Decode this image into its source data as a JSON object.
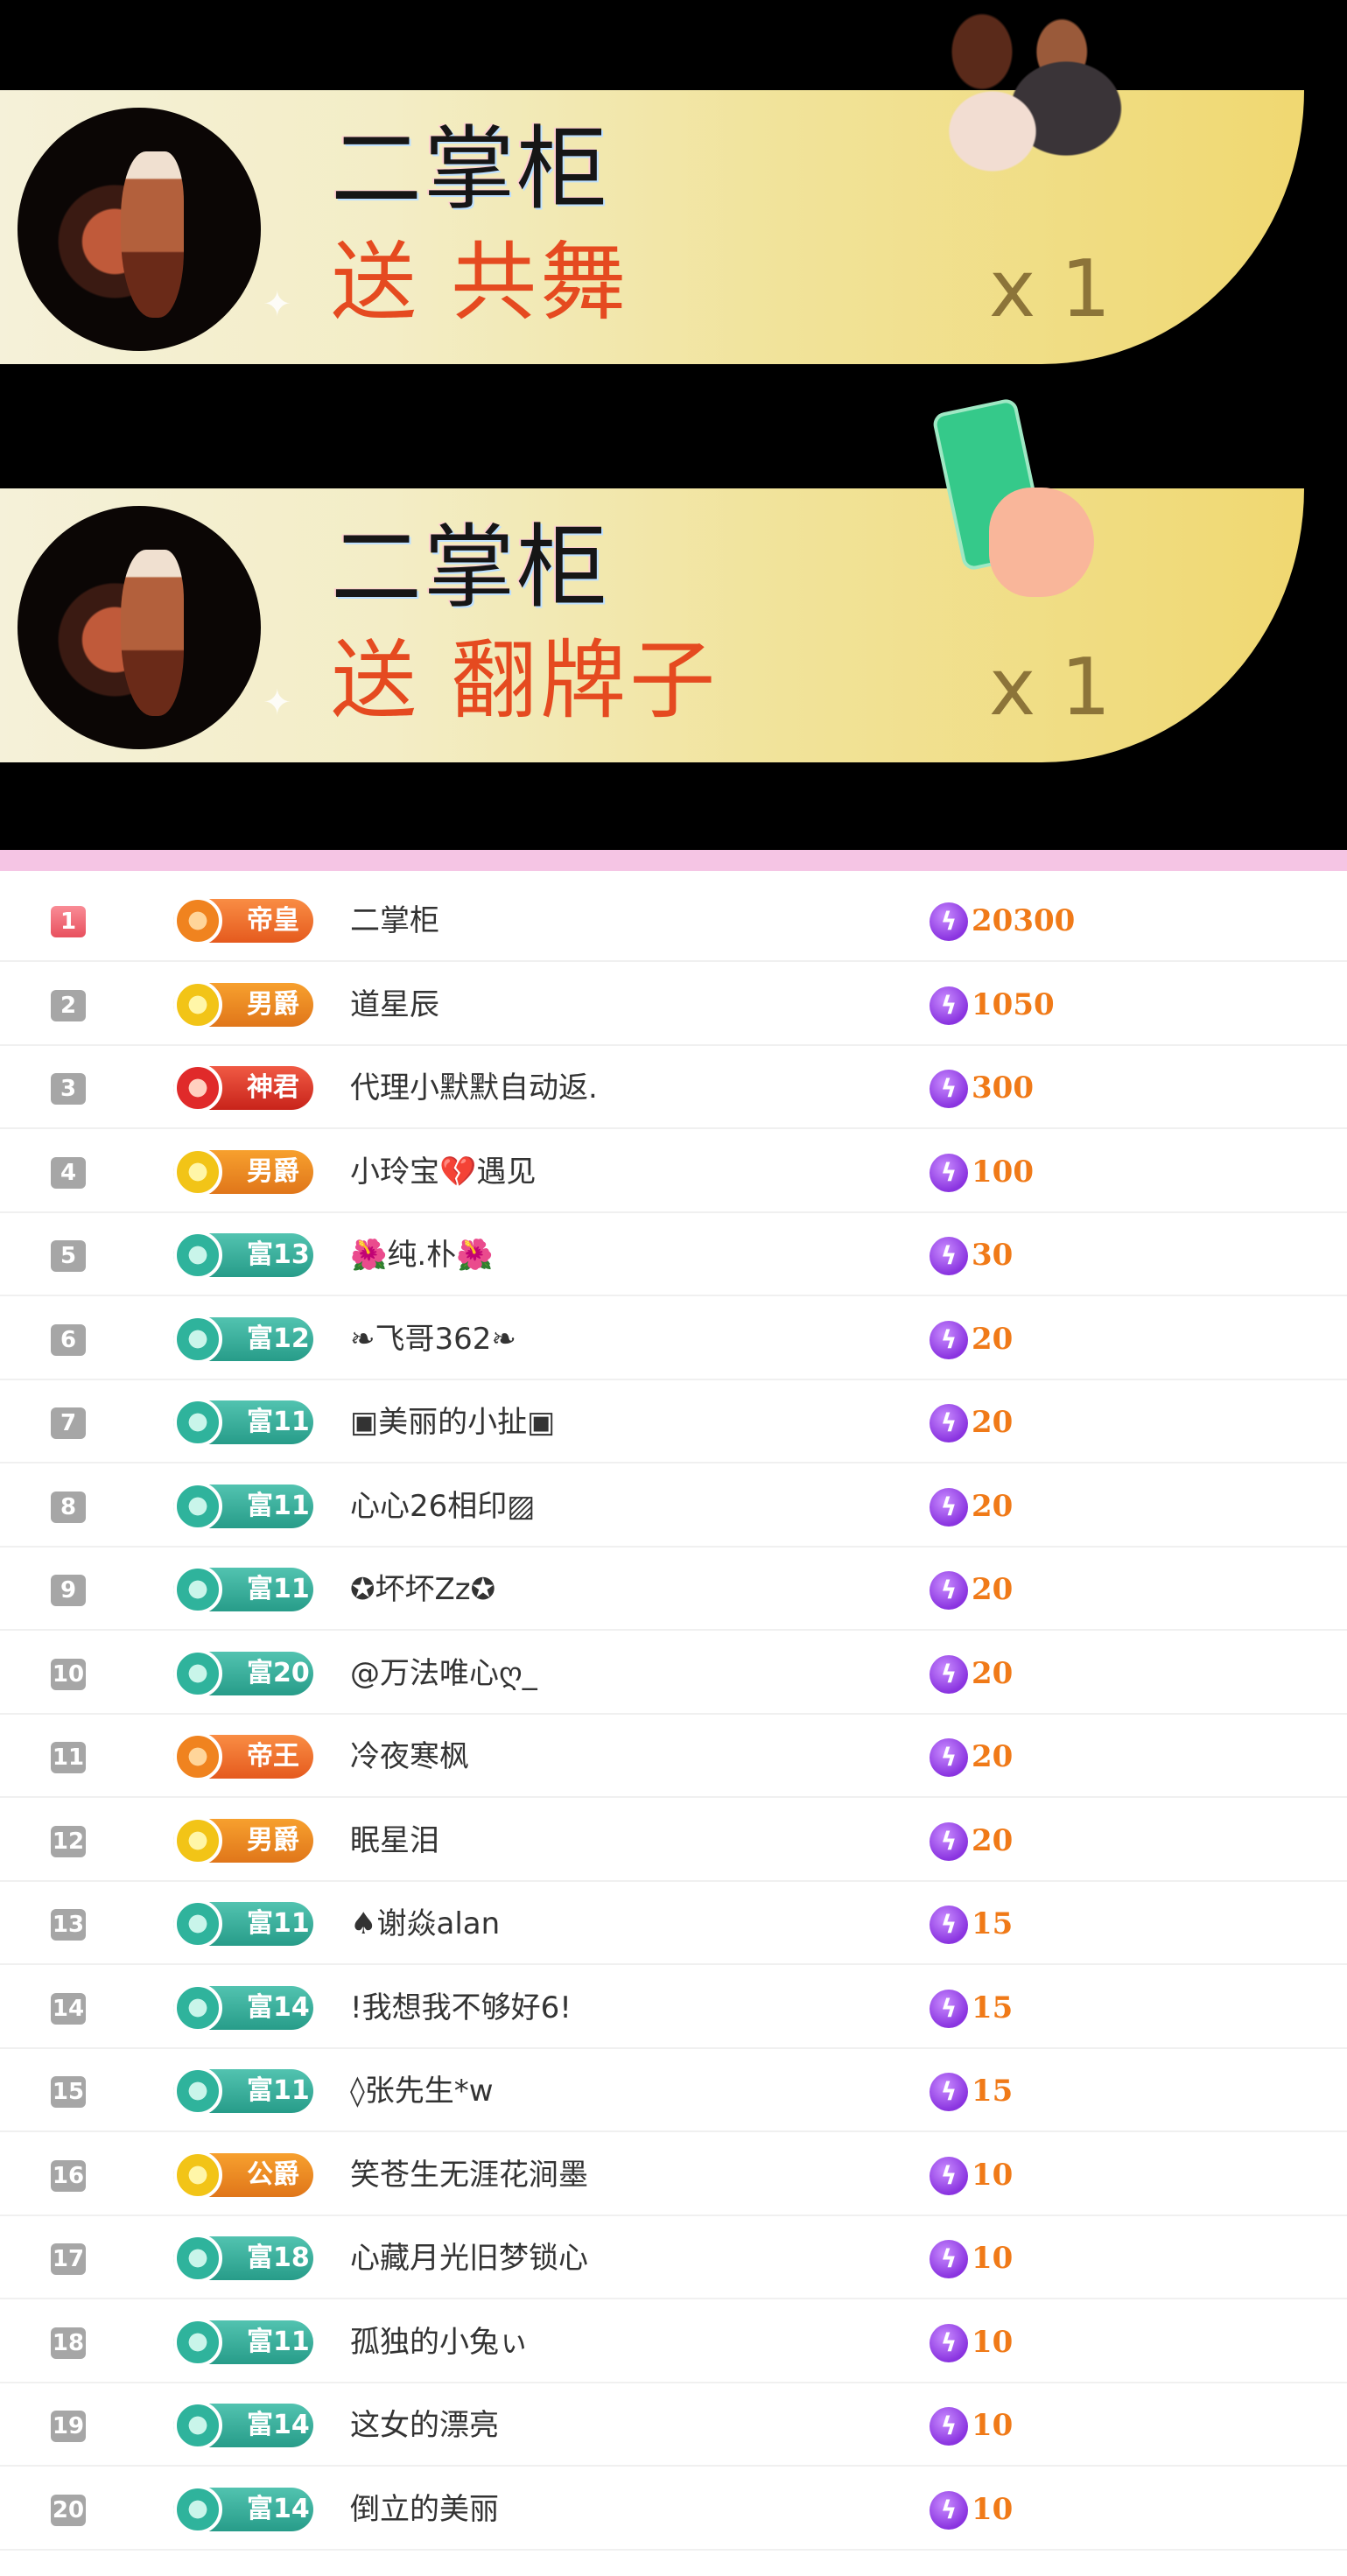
{
  "banners": [
    {
      "sender": "二掌柜",
      "action": "送 共舞",
      "count": "x 1",
      "gift_icon": "couple-dance-gift-icon"
    },
    {
      "sender": "二掌柜",
      "action": "送 翻牌子",
      "count": "x 1",
      "gift_icon": "flip-card-gift-icon"
    }
  ],
  "colors": {
    "accent_pink": "#f5c5e4",
    "amount_orange": "#f07a18",
    "coin_purple": "#8a34e0"
  },
  "ranking": [
    {
      "rank": "1",
      "badge": "帝皇",
      "badge_style": "orange",
      "name": "二掌柜",
      "amount": "20300"
    },
    {
      "rank": "2",
      "badge": "男爵",
      "badge_style": "gold",
      "name": "道星辰",
      "amount": "1050"
    },
    {
      "rank": "3",
      "badge": "神君",
      "badge_style": "red",
      "name": "代理小默默自动返.",
      "amount": "300"
    },
    {
      "rank": "4",
      "badge": "男爵",
      "badge_style": "gold",
      "name": "小玲宝💔遇见",
      "amount": "100"
    },
    {
      "rank": "5",
      "badge": "富13",
      "badge_style": "teal",
      "name": "🌺纯.朴🌺",
      "amount": "30"
    },
    {
      "rank": "6",
      "badge": "富12",
      "badge_style": "teal",
      "name": "❧飞哥362❧",
      "amount": "20"
    },
    {
      "rank": "7",
      "badge": "富11",
      "badge_style": "teal",
      "name": "▣美丽的小扯▣",
      "amount": "20"
    },
    {
      "rank": "8",
      "badge": "富11",
      "badge_style": "teal",
      "name": "心心26相印▨",
      "amount": "20"
    },
    {
      "rank": "9",
      "badge": "富11",
      "badge_style": "teal",
      "name": "✪坏坏Zz✪",
      "amount": "20"
    },
    {
      "rank": "10",
      "badge": "富20",
      "badge_style": "teal",
      "name": "@万法唯心ღ_",
      "amount": "20"
    },
    {
      "rank": "11",
      "badge": "帝王",
      "badge_style": "orange",
      "name": "冷夜寒枫",
      "amount": "20"
    },
    {
      "rank": "12",
      "badge": "男爵",
      "badge_style": "gold",
      "name": "眠星泪",
      "amount": "20"
    },
    {
      "rank": "13",
      "badge": "富11",
      "badge_style": "teal",
      "name": "♠谢焱alan",
      "amount": "15"
    },
    {
      "rank": "14",
      "badge": "富14",
      "badge_style": "teal",
      "name": "!我想我不够好6!",
      "amount": "15"
    },
    {
      "rank": "15",
      "badge": "富11",
      "badge_style": "teal",
      "name": "◊张先生*w",
      "amount": "15"
    },
    {
      "rank": "16",
      "badge": "公爵",
      "badge_style": "gold",
      "name": "笑苍生无涯花涧墨",
      "amount": "10"
    },
    {
      "rank": "17",
      "badge": "富18",
      "badge_style": "teal",
      "name": "心藏月光旧梦锁心",
      "amount": "10"
    },
    {
      "rank": "18",
      "badge": "富11",
      "badge_style": "teal",
      "name": "孤独的小兔ぃ",
      "amount": "10"
    },
    {
      "rank": "19",
      "badge": "富14",
      "badge_style": "teal",
      "name": "这女的漂亮",
      "amount": "10"
    },
    {
      "rank": "20",
      "badge": "富14",
      "badge_style": "teal",
      "name": "倒立的美丽",
      "amount": "10"
    }
  ]
}
